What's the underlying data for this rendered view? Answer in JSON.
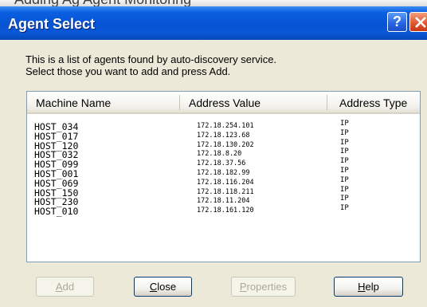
{
  "window": {
    "title": "Agent Select",
    "behind_title_fragment": "Adding Ag    Agent Monitoring",
    "help_glyph": "?",
    "titlebar_color": "#0654d4"
  },
  "instructions": {
    "line1": "This is a list of agents found by auto-discovery service.",
    "line2": "Select those you want to add and press Add."
  },
  "list": {
    "columns": [
      "Machine Name",
      "Address Value",
      "Address Type"
    ],
    "rows": [
      {
        "name": "HOST_034",
        "address": "172.18.254.101",
        "type": "IP"
      },
      {
        "name": "HOST_017",
        "address": "172.18.123.68",
        "type": "IP"
      },
      {
        "name": "HOST_120",
        "address": "172.18.130.202",
        "type": "IP"
      },
      {
        "name": "HOST_032",
        "address": "172.18.8.20",
        "type": "IP"
      },
      {
        "name": "HOST_099",
        "address": "172.18.37.56",
        "type": "IP"
      },
      {
        "name": "HOST_001",
        "address": "172.18.182.99",
        "type": "IP"
      },
      {
        "name": "HOST_069",
        "address": "172.18.116.204",
        "type": "IP"
      },
      {
        "name": "HOST_150",
        "address": "172.18.118.211",
        "type": "IP"
      },
      {
        "name": "HOST_230",
        "address": "172.18.11.204",
        "type": "IP"
      },
      {
        "name": "HOST_010",
        "address": "172.18.161.120",
        "type": "IP"
      }
    ]
  },
  "buttons": {
    "add": {
      "mnemonic": "A",
      "rest": "dd",
      "enabled": false
    },
    "close": {
      "mnemonic": "C",
      "rest": "lose",
      "enabled": true
    },
    "properties": {
      "mnemonic": "P",
      "rest": "roperties",
      "enabled": false
    },
    "help": {
      "mnemonic": "H",
      "rest": "elp",
      "enabled": true
    }
  }
}
